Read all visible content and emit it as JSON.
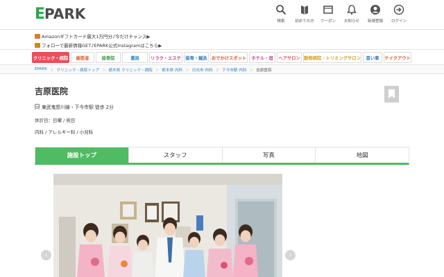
{
  "header": {
    "logo_e": "E",
    "logo_park": "PARK",
    "nav": [
      {
        "label": "検索",
        "icon": "search-icon"
      },
      {
        "label": "初めての方",
        "icon": "book-icon"
      },
      {
        "label": "クーポン",
        "icon": "coupon-icon"
      },
      {
        "label": "お知らせ",
        "icon": "bell-icon"
      },
      {
        "label": "新規登録",
        "icon": "user-icon"
      },
      {
        "label": "ログイン",
        "icon": "login-icon"
      }
    ]
  },
  "promo": {
    "line1": "Amazonギフトカード最大1万円分♪今だけチャンス▶",
    "line2": "フォローで最新情報GET♪EPARK公式Instagramはこちら▶"
  },
  "categories": [
    "クリニック・病院",
    "歯医者",
    "接骨院",
    "薬局",
    "リラク・エステ",
    "接骨・鍼灸",
    "おでかけスポット",
    "ホテル・宿",
    "ヘアサロン",
    "動物病院・トリミングサロン",
    "習い事",
    "テイクアウト"
  ],
  "breadcrumbs": [
    "EPARK",
    "クリニック・病院トップ",
    "栃木県 クリニック・病院",
    "栃木県 内科",
    "日光市 内科",
    "下今市駅 内科",
    "吉原医院"
  ],
  "clinic": {
    "name": "吉原医院",
    "access": "東武鬼怒川線・下今市駅 徒歩 2分",
    "closed": "休診日：日曜 / 祝日",
    "specialties": "内科 / アレルギー科 / 小児科"
  },
  "tabs": [
    "施設トップ",
    "スタッフ",
    "写真",
    "地図"
  ],
  "colors": {
    "brand_green": "#2aa84a",
    "tab_green": "#4fbb63",
    "active_category": "#e8505b"
  }
}
